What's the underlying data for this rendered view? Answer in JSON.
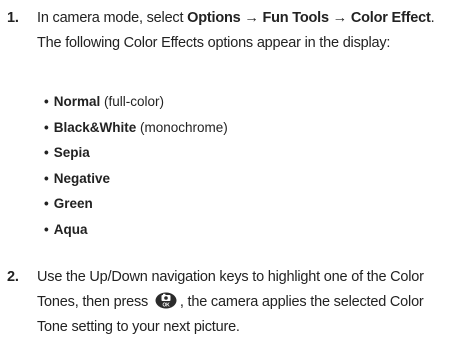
{
  "steps": [
    {
      "number": "1.",
      "prefix": "In camera mode, select ",
      "menu_path": "Options → Fun Tools → Color Effect",
      "suffix": ". The following Color Effects options appear in the display:",
      "options": [
        {
          "name": "Normal",
          "note": " (full-color)"
        },
        {
          "name": "Black&White",
          "note": " (monochrome)"
        },
        {
          "name": "Sepia",
          "note": ""
        },
        {
          "name": "Negative",
          "note": ""
        },
        {
          "name": "Green",
          "note": ""
        },
        {
          "name": "Aqua",
          "note": ""
        }
      ]
    },
    {
      "number": "2.",
      "text_before_icon": "Use the Up/Down navigation keys to highlight one of the Color Tones, then press ",
      "key_icon": "camera-ok-key-icon",
      "text_after_icon": ", the camera applies the selected Color Tone setting to your next picture."
    }
  ]
}
